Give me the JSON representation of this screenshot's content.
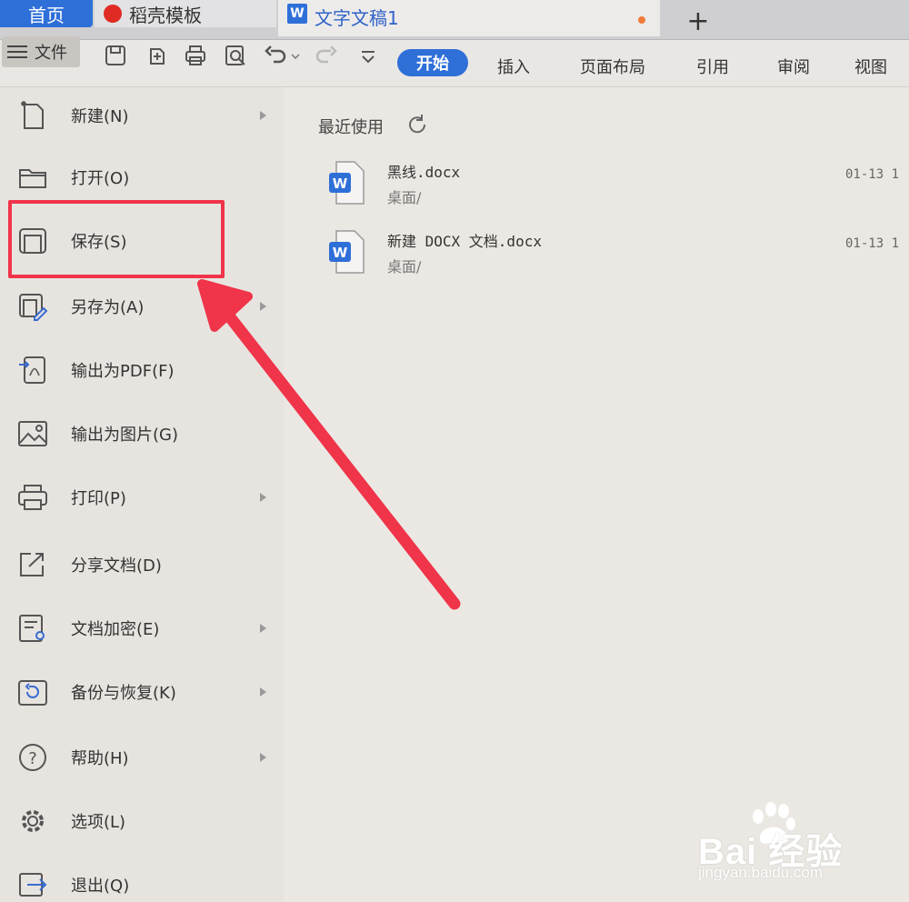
{
  "tabs": {
    "home": "首页",
    "daoke": "稻壳模板",
    "doc": "文字文稿1",
    "add": "+"
  },
  "toolbar": {
    "file_menu": "文件",
    "ribbon_tabs": [
      "开始",
      "插入",
      "页面布局",
      "引用",
      "审阅",
      "视图"
    ],
    "active_tab": "开始"
  },
  "file_menu": {
    "items": [
      {
        "label": "新建(N)",
        "icon": "new-file-icon",
        "submenu": true
      },
      {
        "label": "打开(O)",
        "icon": "folder-icon",
        "submenu": false
      },
      {
        "label": "保存(S)",
        "icon": "save-icon",
        "submenu": false
      },
      {
        "label": "另存为(A)",
        "icon": "save-as-icon",
        "submenu": true
      },
      {
        "label": "输出为PDF(F)",
        "icon": "pdf-export-icon",
        "submenu": false
      },
      {
        "label": "输出为图片(G)",
        "icon": "image-export-icon",
        "submenu": false
      },
      {
        "label": "打印(P)",
        "icon": "printer-icon",
        "submenu": true
      },
      {
        "label": "分享文档(D)",
        "icon": "share-icon",
        "submenu": false
      },
      {
        "label": "文档加密(E)",
        "icon": "encrypt-icon",
        "submenu": true
      },
      {
        "label": "备份与恢复(K)",
        "icon": "backup-icon",
        "submenu": true
      },
      {
        "label": "帮助(H)",
        "icon": "help-icon",
        "submenu": true
      },
      {
        "label": "选项(L)",
        "icon": "gear-icon",
        "submenu": false
      },
      {
        "label": "退出(Q)",
        "icon": "exit-icon",
        "submenu": false
      }
    ]
  },
  "recent": {
    "title": "最近使用",
    "items": [
      {
        "name": "黑线.docx",
        "path": "桌面/",
        "time": "01-13 1"
      },
      {
        "name": "新建 DOCX 文档.docx",
        "path": "桌面/",
        "time": "01-13 1"
      }
    ]
  },
  "watermark": {
    "brand": "Bai 经验",
    "url": "jingyan.baidu.com"
  },
  "colors": {
    "accent": "#2f6fd8",
    "annotation": "#f0344a"
  }
}
